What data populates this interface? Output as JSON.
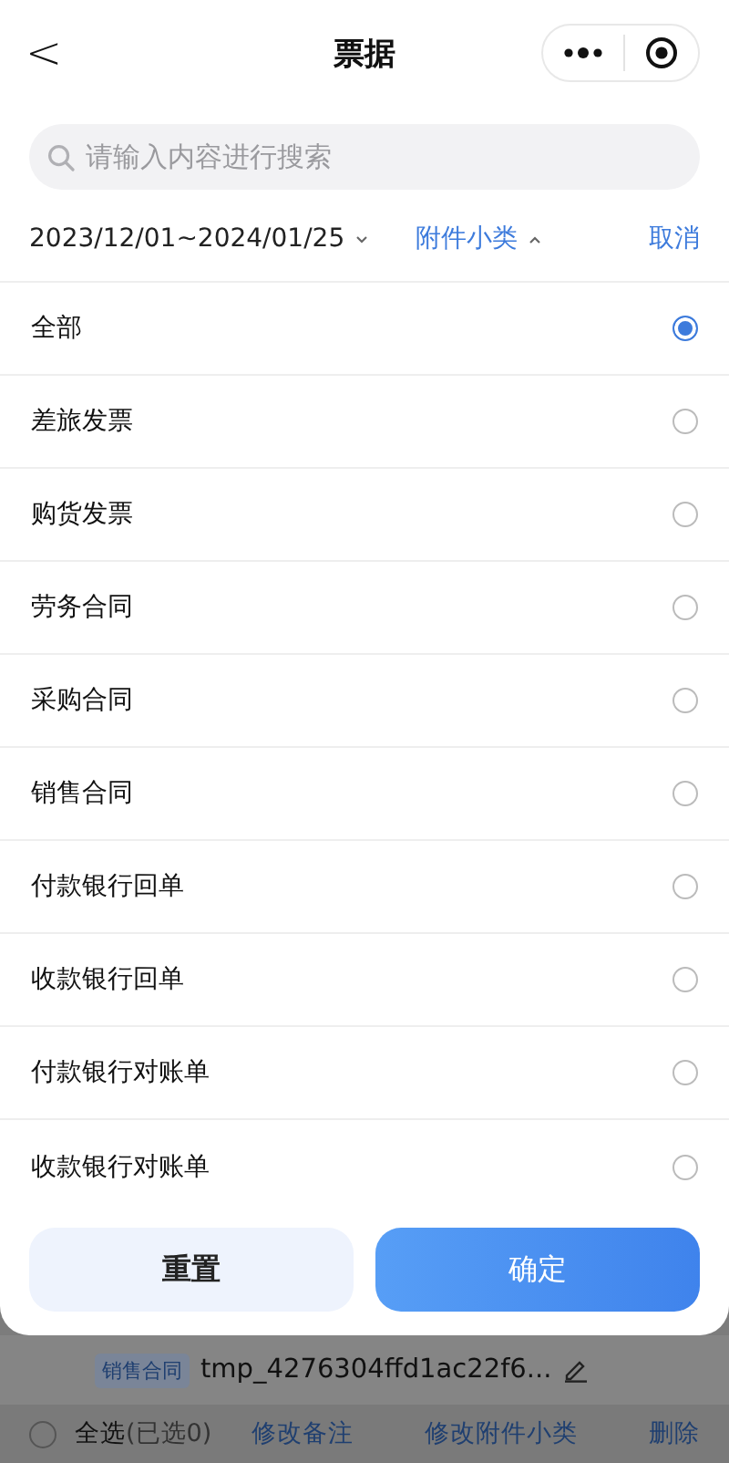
{
  "nav": {
    "back": "<",
    "title": "票据"
  },
  "search": {
    "placeholder": "请输入内容进行搜索"
  },
  "filters": {
    "date_range": "2023/12/01~2024/01/25",
    "category": "附件小类",
    "category_expanded": true,
    "cancel": "取消"
  },
  "options": [
    {
      "label": "全部",
      "selected": true
    },
    {
      "label": "差旅发票",
      "selected": false
    },
    {
      "label": "购货发票",
      "selected": false
    },
    {
      "label": "劳务合同",
      "selected": false
    },
    {
      "label": "采购合同",
      "selected": false
    },
    {
      "label": "销售合同",
      "selected": false
    },
    {
      "label": "付款银行回单",
      "selected": false
    },
    {
      "label": "收款银行回单",
      "selected": false
    },
    {
      "label": "付款银行对账单",
      "selected": false
    },
    {
      "label": "收款银行对账单",
      "selected": false
    }
  ],
  "actions": {
    "reset": "重置",
    "confirm": "确定"
  },
  "background_item": {
    "tag": "销售合同",
    "filename": "tmp_4276304ffd1ac22f6..."
  },
  "bottom_bar": {
    "select_all": "全选",
    "selected_count": "(已选0)",
    "checked": false,
    "edit_note": "修改备注",
    "edit_category": "修改附件小类",
    "delete": "删除"
  }
}
